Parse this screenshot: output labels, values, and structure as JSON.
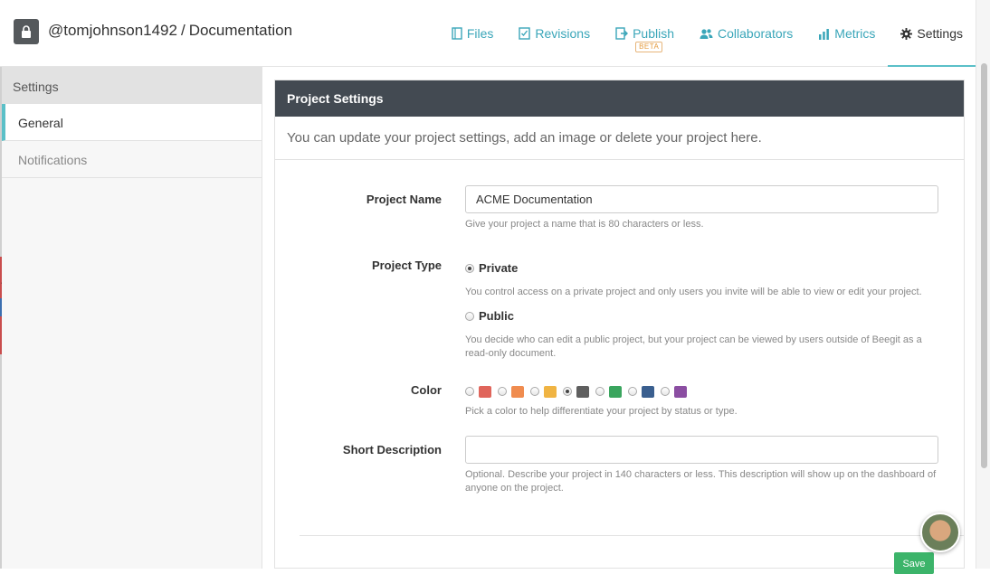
{
  "header": {
    "user": "@tomjohnson1492",
    "separator": "/",
    "project": "Documentation",
    "nav": [
      {
        "label": "Files",
        "icon": "file-icon"
      },
      {
        "label": "Revisions",
        "icon": "checkbox-icon"
      },
      {
        "label": "Publish",
        "icon": "publish-icon",
        "badge": "BETA"
      },
      {
        "label": "Collaborators",
        "icon": "users-icon"
      },
      {
        "label": "Metrics",
        "icon": "bar-chart-icon"
      },
      {
        "label": "Settings",
        "icon": "gear-icon",
        "active": true
      }
    ]
  },
  "sidebar": {
    "heading": "Settings",
    "items": [
      {
        "label": "General",
        "active": true
      },
      {
        "label": "Notifications",
        "active": false
      }
    ]
  },
  "panel": {
    "title": "Project Settings",
    "intro": "You can update your project settings, add an image or delete your project here.",
    "name": {
      "label": "Project Name",
      "value": "ACME Documentation",
      "help": "Give your project a name that is 80 characters or less."
    },
    "type": {
      "label": "Project Type",
      "options": [
        {
          "label": "Private",
          "help": "You control access on a private project and only users you invite will be able to view or edit your project.",
          "checked": true
        },
        {
          "label": "Public",
          "help": "You decide who can edit a public project, but your project can be viewed by users outside of Beegit as a read-only document.",
          "checked": false
        }
      ]
    },
    "color": {
      "label": "Color",
      "swatches": [
        "#e0655b",
        "#f08c4f",
        "#f0b443",
        "#5f5f5f",
        "#3aa55e",
        "#3a5f8f",
        "#8b4ea2"
      ],
      "selected_index": 3,
      "help": "Pick a color to help differentiate your project by status or type."
    },
    "description": {
      "label": "Short Description",
      "value": "",
      "help": "Optional. Describe your project in 140 characters or less. This description will show up on the dashboard of anyone on the project."
    },
    "save_label": "Save"
  },
  "colors": {
    "accent": "#5bc0c8",
    "link": "#3aa6b9",
    "panel_header": "#434a52",
    "save": "#3cb46a"
  }
}
